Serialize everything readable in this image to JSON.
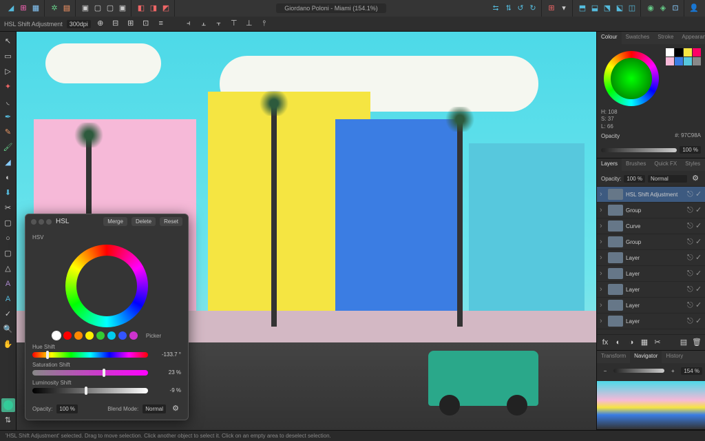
{
  "document_title": "Giordano Poloni - Miami (154.1%)",
  "context_bar": {
    "label": "HSL Shift Adjustment",
    "dpi": "300dpi"
  },
  "colour_panel": {
    "tabs": [
      "Colour",
      "Swatches",
      "Stroke",
      "Appearance"
    ],
    "h": "H: 108",
    "s": "S: 37",
    "l": "L: 66",
    "hex": "#: 97C98A",
    "opacity_label": "Opacity",
    "opacity_value": "100 %",
    "swatches": [
      "#ffffff",
      "#000000",
      "#f6e542",
      "#f06",
      "#f6b9d8",
      "#3b7de3",
      "#57c8dd",
      "#888888"
    ]
  },
  "layers_panel": {
    "tabs": [
      "Layers",
      "Brushes",
      "Quick FX",
      "Styles"
    ],
    "opacity_label": "Opacity:",
    "opacity_value": "100 %",
    "blend_value": "Normal",
    "items": [
      {
        "name": "HSL Shift Adjustment",
        "sel": true
      },
      {
        "name": "Group"
      },
      {
        "name": "Curve"
      },
      {
        "name": "Group"
      },
      {
        "name": "Layer"
      },
      {
        "name": "Layer"
      },
      {
        "name": "Layer"
      },
      {
        "name": "Layer"
      },
      {
        "name": "Layer"
      }
    ]
  },
  "nav_panel": {
    "tabs": [
      "Transform",
      "Navigator",
      "History"
    ],
    "zoom": "154 %"
  },
  "hsl_popup": {
    "title": "HSL",
    "merge": "Merge",
    "delete": "Delete",
    "reset": "Reset",
    "mode": "HSV",
    "picker": "Picker",
    "hue_label": "Hue Shift",
    "hue_val": "-133.7 °",
    "sat_label": "Saturation Shift",
    "sat_val": "23 %",
    "lum_label": "Luminosity Shift",
    "lum_val": "-9 %",
    "opacity_label": "Opacity:",
    "opacity_val": "100 %",
    "blend_label": "Blend Mode:",
    "blend_val": "Normal",
    "dots": [
      "#ffffff",
      "#ff0000",
      "#ff8800",
      "#ffee00",
      "#33cc33",
      "#00ccee",
      "#3355ff",
      "#cc33cc"
    ]
  },
  "status": "'HSL Shift Adjustment' selected. Drag to move selection. Click another object to select it. Click on an empty area to deselect selection."
}
